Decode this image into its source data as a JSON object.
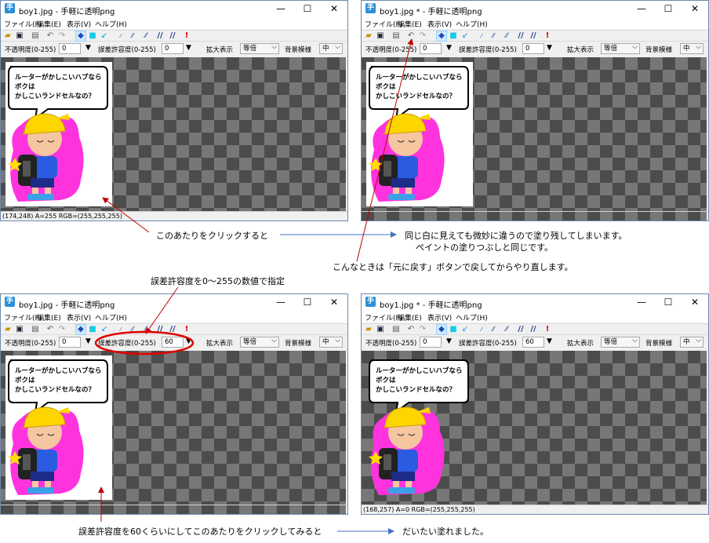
{
  "windows": [
    {
      "title": "boy1.jpg - 手軽に透明png",
      "status": "(174,248) A=255 RGB=(255,255,255)",
      "tolerance": "0",
      "partial": false,
      "transparent": false
    },
    {
      "title": "boy1.jpg * - 手軽に透明png",
      "status": "",
      "tolerance": "0",
      "partial": true,
      "transparent": false
    },
    {
      "title": "boy1.jpg - 手軽に透明png",
      "status": "",
      "tolerance": "60",
      "partial": false,
      "transparent": false,
      "highlight": true
    },
    {
      "title": "boy1.jpg * - 手軽に透明png",
      "status": "(168,257) A=0 RGB=(255,255,255)",
      "tolerance": "60",
      "partial": false,
      "transparent": true
    }
  ],
  "menu": {
    "file": "ファイル(F)",
    "edit": "編集(E)",
    "view": "表示(V)",
    "help": "ヘルプ(H)"
  },
  "controls": {
    "opacity_label": "不透明度(0-255)",
    "opacity_value": "0",
    "tolerance_label": "誤差許容度(0-255)",
    "zoom_label": "拡大表示",
    "zoom_value": "等倍",
    "bg_label": "背景模様",
    "bg_value": "中"
  },
  "caption_window": {
    "min": "—",
    "max": "☐",
    "close": "✕"
  },
  "image": {
    "bubble_line1": "ルーターがかしこいハブなら",
    "bubble_line2": "ボクは",
    "bubble_line3": "かしこいランドセルなの？"
  },
  "notes": {
    "click_here": "このあたりをクリックすると",
    "result1_line1": "同じ白に見えても微妙に違うので塗り残してしまいます。",
    "result1_line2": "ペイントの塗りつぶしと同じです。",
    "undo_hint": "こんなときは「元に戻す」ボタンで戻してからやり直します。",
    "tolerance_hint": "誤差許容度を0～255の数値で指定",
    "click_60": "誤差許容度を60くらいにしてこのあたりをクリックしてみると",
    "result2": "だいたい塗れました。"
  }
}
